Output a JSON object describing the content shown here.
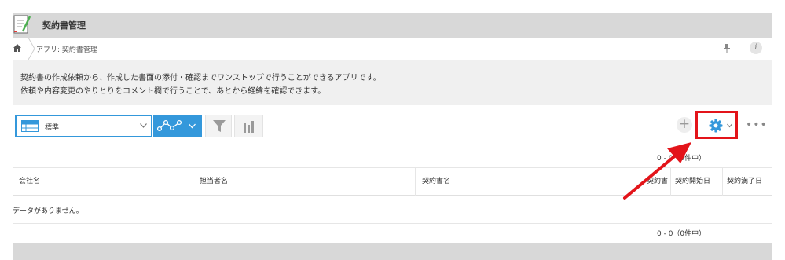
{
  "header": {
    "title": "契約書管理",
    "icon": "contract-app-icon"
  },
  "breadcrumb": {
    "text": "アプリ: 契約書管理",
    "home_icon": "home-icon",
    "pin_icon": "pin-icon",
    "info_icon": "info-icon",
    "info_label": "i"
  },
  "description": {
    "line1": "契約書の作成依頼から、作成した書面の添付・確認までワンストップで行うことができるアプリです。",
    "line2": "依頼や内容変更のやりとりをコメント欄で行うことで、あとから経緯を確認できます。"
  },
  "toolbar": {
    "view_label": "標準",
    "add_label": "+",
    "more_label": "•••",
    "accent_color": "#3498db",
    "highlight_color": "#e3141a"
  },
  "pager": {
    "top": "0 - 0（0件中）",
    "bottom": "0 - 0（0件中）"
  },
  "table": {
    "columns": [
      "会社名",
      "担当者名",
      "契約書名",
      "契約書",
      "契約開始日",
      "契約満了日"
    ],
    "empty_message": "データがありません。"
  }
}
